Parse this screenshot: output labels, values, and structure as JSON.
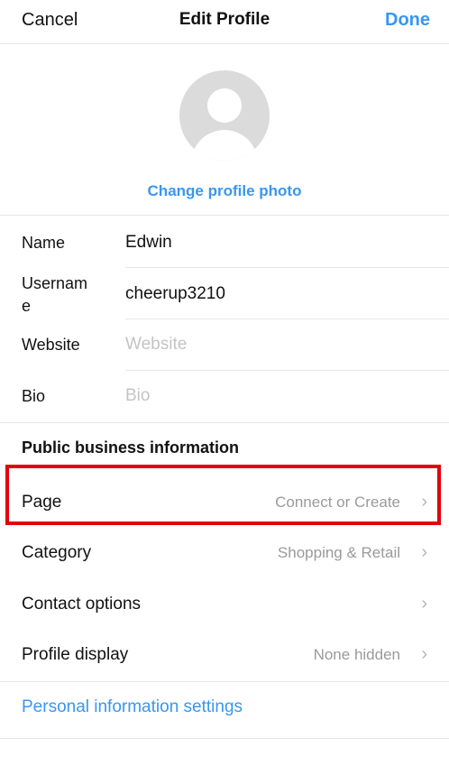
{
  "nav": {
    "cancel_label": "Cancel",
    "title": "Edit Profile",
    "done_label": "Done"
  },
  "profile": {
    "change_photo_label": "Change profile photo"
  },
  "fields": {
    "name": {
      "label": "Name",
      "value": "Edwin"
    },
    "username": {
      "label_line1": "Usernam",
      "label_line2": "e",
      "value": "cheerup3210"
    },
    "website": {
      "label": "Website",
      "placeholder": "Website"
    },
    "bio": {
      "label": "Bio",
      "placeholder": "Bio"
    }
  },
  "business": {
    "section_title": "Public business information",
    "rows": [
      {
        "label": "Page",
        "value": "Connect or Create"
      },
      {
        "label": "Category",
        "value": "Shopping & Retail"
      },
      {
        "label": "Contact options",
        "value": ""
      },
      {
        "label": "Profile display",
        "value": "None hidden"
      }
    ]
  },
  "footer": {
    "personal_info_label": "Personal information settings"
  },
  "icons": {
    "chevron": "chevron-right-icon",
    "avatar": "default-avatar-icon"
  },
  "colors": {
    "accent": "#3897f0",
    "highlight": "#e3000f",
    "separator": "#e6e6e6",
    "muted": "#9a9a9a"
  }
}
